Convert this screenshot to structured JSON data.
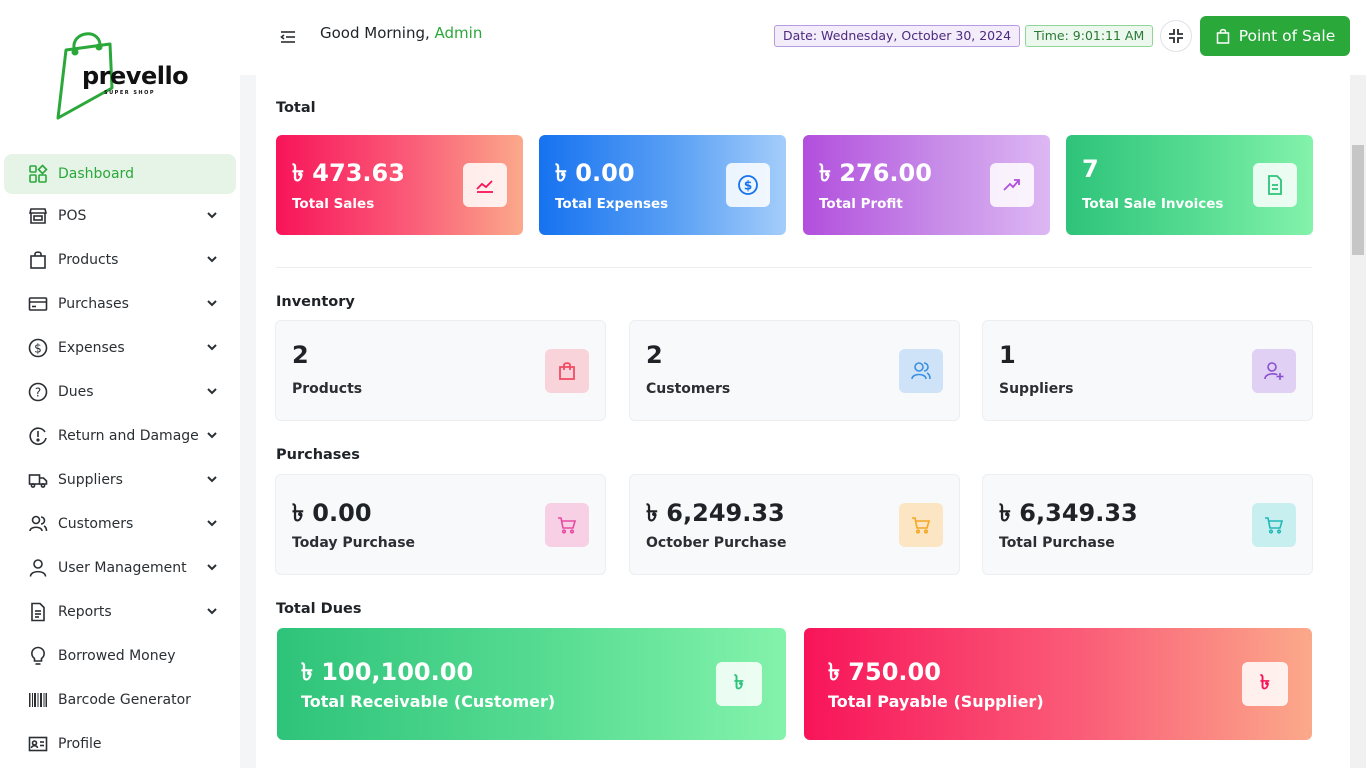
{
  "brand": {
    "name": "prevello",
    "tagline": "SUPER SHOP"
  },
  "sidebar": {
    "items": [
      {
        "label": "Dashboard",
        "icon": "dashboard-icon",
        "active": true
      },
      {
        "label": "POS",
        "icon": "store-icon"
      },
      {
        "label": "Products",
        "icon": "bag-icon"
      },
      {
        "label": "Purchases",
        "icon": "credit-card-icon"
      },
      {
        "label": "Expenses",
        "icon": "dollar-circle-icon"
      },
      {
        "label": "Dues",
        "icon": "question-circle-icon"
      },
      {
        "label": "Return and Damage",
        "icon": "return-icon"
      },
      {
        "label": "Suppliers",
        "icon": "truck-icon"
      },
      {
        "label": "Customers",
        "icon": "users-icon"
      },
      {
        "label": "User Management",
        "icon": "user-icon"
      },
      {
        "label": "Reports",
        "icon": "report-icon"
      },
      {
        "label": "Borrowed Money",
        "icon": "bulb-icon"
      },
      {
        "label": "Barcode Generator",
        "icon": "barcode-icon"
      },
      {
        "label": "Profile",
        "icon": "id-card-icon"
      }
    ]
  },
  "header": {
    "greeting": "Good Morning, ",
    "user": "Admin",
    "date": "Date: Wednesday, October 30, 2024",
    "time": "Time: 9:01:11 AM",
    "pos_button": "Point of Sale"
  },
  "total": {
    "title": "Total",
    "cards": [
      {
        "value": "৳ 473.63",
        "label": "Total Sales",
        "icon": "chart-line-icon",
        "color": "#f8145a"
      },
      {
        "value": "৳ 0.00",
        "label": "Total Expenses",
        "icon": "dollar-icon",
        "color": "#1672f0"
      },
      {
        "value": "৳ 276.00",
        "label": "Total Profit",
        "icon": "trend-up-icon",
        "color": "#b24fdd"
      },
      {
        "value": "7",
        "label": "Total Sale Invoices",
        "icon": "invoice-icon",
        "color": "#2ec37a"
      }
    ]
  },
  "inventory": {
    "title": "Inventory",
    "cards": [
      {
        "value": "2",
        "label": "Products",
        "icon": "shopping-bag-icon",
        "color": "#f04d65"
      },
      {
        "value": "2",
        "label": "Customers",
        "icon": "customers-icon",
        "color": "#3b8fe0"
      },
      {
        "value": "1",
        "label": "Suppliers",
        "icon": "supplier-add-icon",
        "color": "#8a4fd0"
      }
    ]
  },
  "purchases": {
    "title": "Purchases",
    "cards": [
      {
        "value": "৳ 0.00",
        "label": "Today Purchase",
        "icon": "cart-icon",
        "color": "#e64aa0"
      },
      {
        "value": "৳ 6,249.33",
        "label": "October Purchase",
        "icon": "cart-icon",
        "color": "#f5a623"
      },
      {
        "value": "৳ 6,349.33",
        "label": "Total Purchase",
        "icon": "cart-icon",
        "color": "#22b8b8"
      }
    ]
  },
  "dues": {
    "title": "Total Dues",
    "cards": [
      {
        "value": "৳ 100,100.00",
        "label": "Total Receivable (Customer)",
        "icon_text": "৳"
      },
      {
        "value": "৳ 750.00",
        "label": "Total Payable (Supplier)",
        "icon_text": "৳"
      }
    ]
  }
}
